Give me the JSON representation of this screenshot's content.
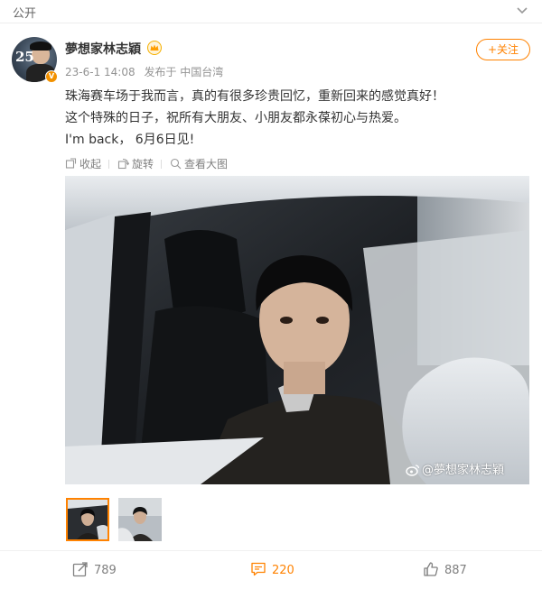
{
  "header": {
    "visibility": "公开"
  },
  "author": {
    "name": "夢想家林志穎",
    "avatar_text": "25",
    "verified_badge": "V",
    "follow_label": "+关注",
    "post_time": "23-6-1 14:08",
    "post_source": "发布于 中国台湾"
  },
  "post": {
    "lines": [
      "珠海赛车场于我而言，真的有很多珍贵回忆，重新回来的感觉真好！",
      "这个特殊的日子，祝所有大朋友、小朋友都永葆初心与热爱。",
      "I'm back， 6月6日见!"
    ]
  },
  "media_actions": {
    "collapse": "收起",
    "rotate": "旋转",
    "view_large": "查看大图"
  },
  "photo": {
    "watermark": "@夢想家林志穎"
  },
  "thumbnails": [
    {
      "label": "thumbnail-1",
      "selected": true
    },
    {
      "label": "thumbnail-2",
      "selected": false
    }
  ],
  "footer": {
    "reposts": "789",
    "comments": "220",
    "likes": "887"
  },
  "colors": {
    "accent": "#ff8200",
    "verified": "#f29100",
    "muted": "#808080"
  },
  "icons": [
    "chevron-down-icon",
    "crown-icon",
    "collapse-icon",
    "rotate-icon",
    "zoom-icon",
    "weibo-logo-icon",
    "repost-icon",
    "comment-icon",
    "like-icon"
  ]
}
